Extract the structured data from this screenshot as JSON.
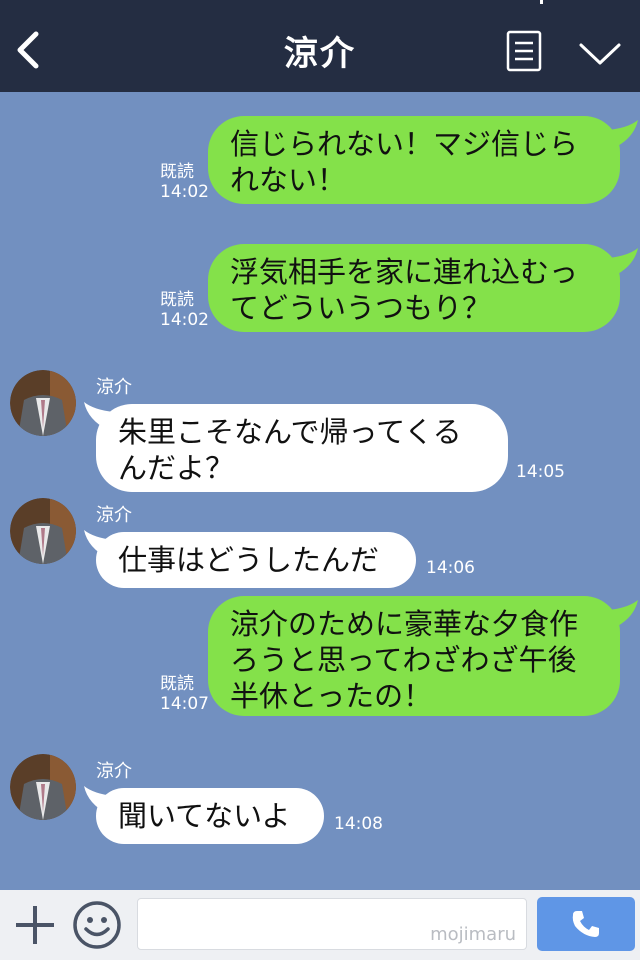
{
  "header": {
    "title": "涼介"
  },
  "messages": [
    {
      "dir": "out",
      "lines": [
        "信じられない！マジ信じら",
        "れない！"
      ],
      "read": "既読",
      "time": "14:02"
    },
    {
      "dir": "out",
      "lines": [
        "浮気相手を家に連れ込むっ",
        "てどういうつもり？"
      ],
      "read": "既読",
      "time": "14:02"
    },
    {
      "dir": "in",
      "sender": "涼介",
      "lines": [
        "朱里こそなんで帰ってくる",
        "んだよ？"
      ],
      "time": "14:05"
    },
    {
      "dir": "in",
      "sender": "涼介",
      "lines": [
        "仕事はどうしたんだ"
      ],
      "time": "14:06"
    },
    {
      "dir": "out",
      "lines": [
        "涼介のために豪華な夕食作",
        "ろうと思ってわざわざ午後",
        "半休とったの！"
      ],
      "read": "既読",
      "time": "14:07"
    },
    {
      "dir": "in",
      "sender": "涼介",
      "lines": [
        "聞いてないよ"
      ],
      "time": "14:08"
    }
  ],
  "footer": {
    "input_value": "",
    "watermark": "mojimaru"
  },
  "icons": {
    "back": "chevron-left-icon",
    "menu": "list-icon",
    "down": "chevron-down-icon",
    "plus": "plus-icon",
    "emoji": "smiley-icon",
    "call": "phone-icon"
  },
  "colors": {
    "header": "#242d42",
    "chat_bg": "#7290c0",
    "out_bubble": "#84e14a",
    "in_bubble": "#ffffff",
    "call": "#5f96e6"
  }
}
